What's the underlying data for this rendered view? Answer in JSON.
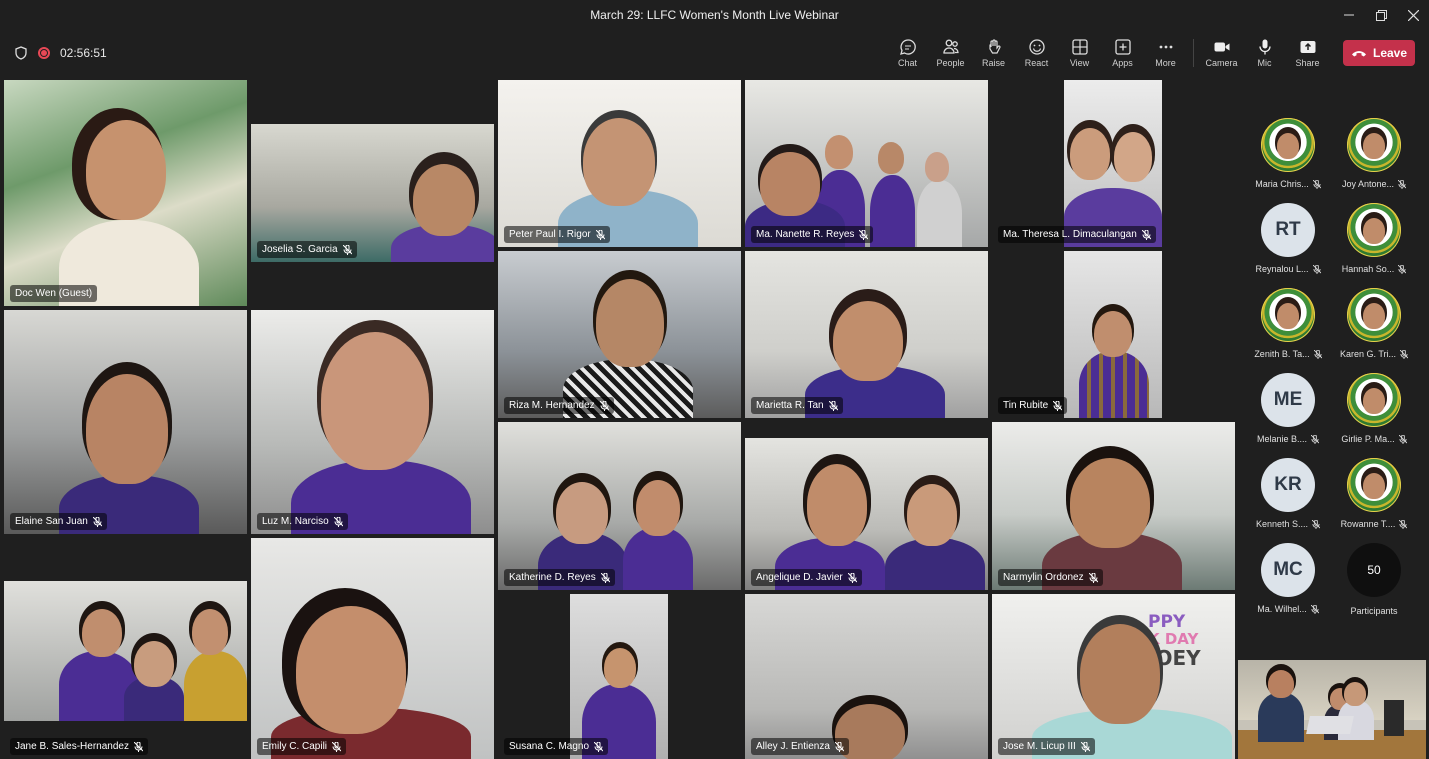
{
  "window": {
    "title": "March 29: LLFC Women's Month Live Webinar"
  },
  "meeting": {
    "timer": "02:56:51"
  },
  "toolbar": {
    "chat": "Chat",
    "people": "People",
    "raise": "Raise",
    "react": "React",
    "view": "View",
    "apps": "Apps",
    "more": "More",
    "camera": "Camera",
    "mic": "Mic",
    "share": "Share",
    "leave": "Leave"
  },
  "tiles": [
    {
      "name": "Doc Wen (Guest)"
    },
    {
      "name": "Joselia S. Garcia"
    },
    {
      "name": "Peter Paul I. Rigor"
    },
    {
      "name": "Ma. Nanette R. Reyes"
    },
    {
      "name": "Ma. Theresa L. Dimaculangan"
    },
    {
      "name": "Riza M. Hernandez"
    },
    {
      "name": "Marietta R. Tan"
    },
    {
      "name": "Tin Rubite"
    },
    {
      "name": "Elaine San Juan"
    },
    {
      "name": "Luz M. Narciso"
    },
    {
      "name": "Katherine D. Reyes"
    },
    {
      "name": "Angelique D. Javier"
    },
    {
      "name": "Narmylin Ordonez"
    },
    {
      "name": "Jane B. Sales-Hernandez"
    },
    {
      "name": "Emily C. Capili"
    },
    {
      "name": "Susana C. Magno"
    },
    {
      "name": "Alley J. Entienza"
    },
    {
      "name": "Jose M. Licup III"
    }
  ],
  "participants": [
    {
      "name": "Maria Chris...",
      "initials": ""
    },
    {
      "name": "Joy Antone...",
      "initials": ""
    },
    {
      "name": "Reynalou L...",
      "initials": "RT"
    },
    {
      "name": "Hannah So...",
      "initials": ""
    },
    {
      "name": "Zenith B. Ta...",
      "initials": ""
    },
    {
      "name": "Karen G. Tri...",
      "initials": ""
    },
    {
      "name": "Melanie B....",
      "initials": "ME"
    },
    {
      "name": "Girlie P. Ma...",
      "initials": ""
    },
    {
      "name": "Kenneth S....",
      "initials": "KR"
    },
    {
      "name": "Rowanne T....",
      "initials": ""
    },
    {
      "name": "Ma. Wilhel...",
      "initials": "MC"
    }
  ],
  "participant_count": {
    "value": "50",
    "label": "Participants"
  },
  "self_view": {
    "wall_text_line1": "PPY",
    "wall_text_line2": "K DAY",
    "wall_text_line3": "JOEY"
  },
  "colors": {
    "leave": "#c4314b",
    "recording": "#e74856",
    "purple_shirt": "#4b2d94",
    "avatar_bg": "#dce3ea"
  }
}
